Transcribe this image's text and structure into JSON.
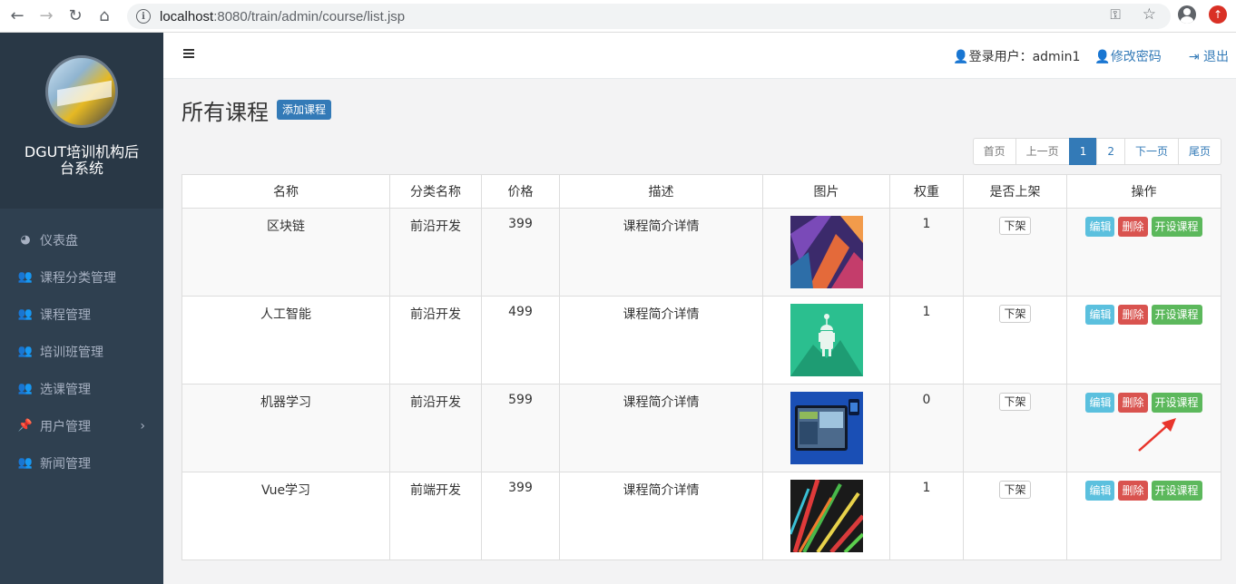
{
  "browser": {
    "url_host": "localhost",
    "url_path": ":8080/train/admin/course/list.jsp"
  },
  "sidebar": {
    "title": "DGUT培训机构后台系统",
    "items": [
      {
        "label": "仪表盘",
        "icon": "dashboard-icon"
      },
      {
        "label": "课程分类管理",
        "icon": "users-icon"
      },
      {
        "label": "课程管理",
        "icon": "users-icon"
      },
      {
        "label": "培训班管理",
        "icon": "users-icon"
      },
      {
        "label": "选课管理",
        "icon": "users-icon"
      },
      {
        "label": "用户管理",
        "icon": "pin-icon",
        "has_children": true
      },
      {
        "label": "新闻管理",
        "icon": "users-icon"
      }
    ]
  },
  "topbar": {
    "user_label": "登录用户：admin1",
    "change_password": "修改密码",
    "logout": "退出"
  },
  "page": {
    "title": "所有课程",
    "add_button": "添加课程"
  },
  "pagination": {
    "first": "首页",
    "prev": "上一页",
    "pages": [
      "1",
      "2"
    ],
    "current": "1",
    "next": "下一页",
    "last": "尾页"
  },
  "table": {
    "headers": [
      "名称",
      "分类名称",
      "价格",
      "描述",
      "图片",
      "权重",
      "是否上架",
      "操作"
    ],
    "rows": [
      {
        "name": "区块链",
        "category": "前沿开发",
        "price": "399",
        "desc": "课程简介详情",
        "weight": "1",
        "shelf_btn": "下架"
      },
      {
        "name": "人工智能",
        "category": "前沿开发",
        "price": "499",
        "desc": "课程简介详情",
        "weight": "1",
        "shelf_btn": "下架"
      },
      {
        "name": "机器学习",
        "category": "前沿开发",
        "price": "599",
        "desc": "课程简介详情",
        "weight": "0",
        "shelf_btn": "下架"
      },
      {
        "name": "Vue学习",
        "category": "前端开发",
        "price": "399",
        "desc": "课程简介详情",
        "weight": "1",
        "shelf_btn": "下架"
      }
    ],
    "actions": {
      "edit": "编辑",
      "delete": "删除",
      "open": "开设课程"
    }
  },
  "colors": {
    "sidebar_bg": "#2f4050",
    "primary": "#337ab7",
    "info": "#5bc0de",
    "danger": "#d9534f",
    "success": "#5cb85c",
    "annotation_arrow": "#e8352c"
  }
}
